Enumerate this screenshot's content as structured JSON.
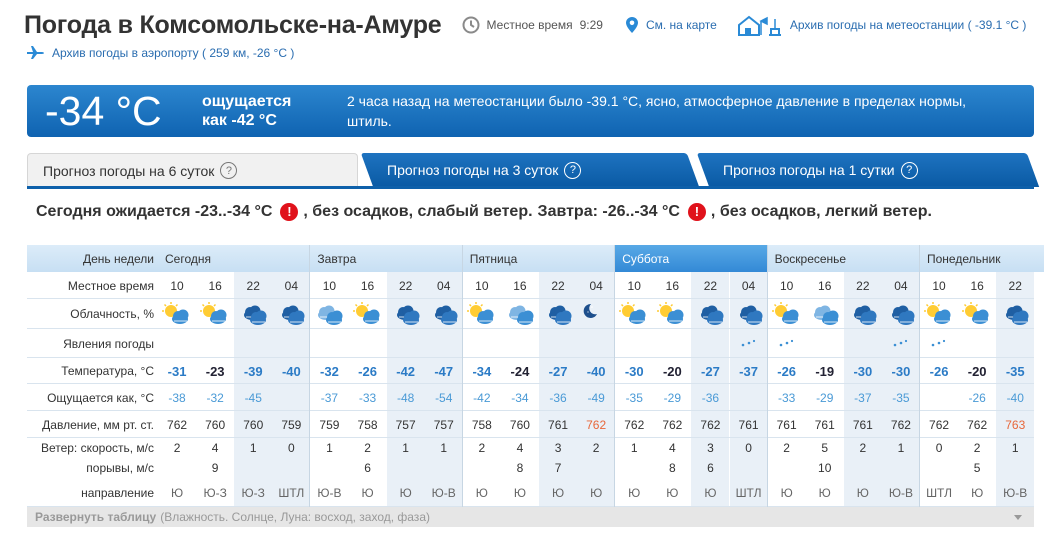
{
  "header": {
    "title": "Погода в Комсомольске-на-Амуре",
    "local_time_label": "Местное время",
    "local_time": "9:29",
    "map_link": "См. на карте",
    "archive_station": "Архив погоды на метеостанции ( -39.1 °C )",
    "archive_airport": "Архив погоды в аэропорту ( 259 км, -26 °C )"
  },
  "current": {
    "temp": "-34 °C",
    "feels_label": "ощущается",
    "feels_value": "как -42 °C",
    "description": "2 часа назад на метеостанции было -39.1 °C, ясно, атмосферное давление в пределах нормы, штиль."
  },
  "tabs": [
    {
      "label": "Прогноз погоды на 6 суток",
      "active": true
    },
    {
      "label": "Прогноз погоды на 3 суток"
    },
    {
      "label": "Прогноз погоды на 1 сутки"
    }
  ],
  "help_icon": "?",
  "summary": {
    "today": "Сегодня ожидается -23..-34 °C",
    "today_rest": ", без осадков, слабый ветер.",
    "tomorrow": "Завтра: -26..-34 °C",
    "tomorrow_rest": ", без осадков, легкий ветер.",
    "alert_symbol": "!"
  },
  "row_labels": {
    "weekday": "День недели",
    "local_time": "Местное время",
    "cloud": "Облачность, %",
    "phenomena": "Явления погоды",
    "temperature": "Температура, °C",
    "feels": "Ощущается как, °C",
    "pressure": "Давление, мм рт. ст.",
    "wind_speed": "Ветер: скорость, м/с",
    "gusts": "порывы, м/с",
    "direction": "направление"
  },
  "days": [
    {
      "name": "Сегодня",
      "weekend": false
    },
    {
      "name": "Завтра",
      "weekend": false
    },
    {
      "name": "Пятница",
      "weekend": false
    },
    {
      "name": "Суббота",
      "weekend": true
    },
    {
      "name": "Воскресенье",
      "weekend": false
    },
    {
      "name": "Понедельник",
      "weekend": false
    }
  ],
  "columns": [
    {
      "time": "10",
      "icon": "sun-cloud",
      "snow": false,
      "temp": "-31",
      "feels": "-38",
      "pressure": "762",
      "wind": "2",
      "gust": "",
      "dir": "Ю"
    },
    {
      "time": "16",
      "icon": "sun-cloud",
      "snow": false,
      "temp": "-23",
      "feels": "-32",
      "pressure": "760",
      "wind": "4",
      "gust": "9",
      "dir": "Ю-З"
    },
    {
      "time": "22",
      "icon": "moon-cloud",
      "snow": false,
      "temp": "-39",
      "feels": "-45",
      "pressure": "760",
      "wind": "1",
      "gust": "",
      "dir": "Ю-З"
    },
    {
      "time": "04",
      "icon": "moon-cloud",
      "snow": false,
      "temp": "-40",
      "feels": "",
      "pressure": "759",
      "wind": "0",
      "gust": "",
      "dir": "ШТЛ"
    },
    {
      "time": "10",
      "icon": "cloudy",
      "snow": false,
      "temp": "-32",
      "feels": "-37",
      "pressure": "759",
      "wind": "1",
      "gust": "",
      "dir": "Ю-В"
    },
    {
      "time": "16",
      "icon": "sun-cloud",
      "snow": false,
      "temp": "-26",
      "feels": "-33",
      "pressure": "758",
      "wind": "2",
      "gust": "6",
      "dir": "Ю"
    },
    {
      "time": "22",
      "icon": "moon-cloud",
      "snow": false,
      "temp": "-42",
      "feels": "-48",
      "pressure": "757",
      "wind": "1",
      "gust": "",
      "dir": "Ю"
    },
    {
      "time": "04",
      "icon": "moon-cloud",
      "snow": false,
      "temp": "-47",
      "feels": "-54",
      "pressure": "757",
      "wind": "1",
      "gust": "",
      "dir": "Ю-В"
    },
    {
      "time": "10",
      "icon": "sun-cloud",
      "snow": false,
      "temp": "-34",
      "feels": "-42",
      "pressure": "758",
      "wind": "2",
      "gust": "",
      "dir": "Ю"
    },
    {
      "time": "16",
      "icon": "cloudy",
      "snow": false,
      "temp": "-24",
      "feels": "-34",
      "pressure": "760",
      "wind": "4",
      "gust": "8",
      "dir": "Ю"
    },
    {
      "time": "22",
      "icon": "moon-cloud",
      "snow": false,
      "temp": "-27",
      "feels": "-36",
      "pressure": "761",
      "wind": "3",
      "gust": "7",
      "dir": "Ю"
    },
    {
      "time": "04",
      "icon": "moon",
      "snow": false,
      "temp": "-40",
      "feels": "-49",
      "pressure": "762",
      "wind": "2",
      "gust": "",
      "dir": "Ю",
      "pressure_hl": true
    },
    {
      "time": "10",
      "icon": "sun-cloud",
      "snow": false,
      "temp": "-30",
      "feels": "-35",
      "pressure": "762",
      "wind": "1",
      "gust": "",
      "dir": "Ю"
    },
    {
      "time": "16",
      "icon": "sun-cloud",
      "snow": false,
      "temp": "-20",
      "feels": "-29",
      "pressure": "762",
      "wind": "4",
      "gust": "8",
      "dir": "Ю"
    },
    {
      "time": "22",
      "icon": "moon-cloud",
      "snow": false,
      "temp": "-27",
      "feels": "-36",
      "pressure": "762",
      "wind": "3",
      "gust": "6",
      "dir": "Ю"
    },
    {
      "time": "04",
      "icon": "moon-cloud",
      "snow": true,
      "temp": "-37",
      "feels": "",
      "pressure": "761",
      "wind": "0",
      "gust": "",
      "dir": "ШТЛ"
    },
    {
      "time": "10",
      "icon": "sun-cloud",
      "snow": true,
      "temp": "-26",
      "feels": "-33",
      "pressure": "761",
      "wind": "2",
      "gust": "",
      "dir": "Ю"
    },
    {
      "time": "16",
      "icon": "cloudy",
      "snow": false,
      "temp": "-19",
      "feels": "-29",
      "pressure": "761",
      "wind": "5",
      "gust": "10",
      "dir": "Ю"
    },
    {
      "time": "22",
      "icon": "moon-cloud",
      "snow": false,
      "temp": "-30",
      "feels": "-37",
      "pressure": "761",
      "wind": "2",
      "gust": "",
      "dir": "Ю"
    },
    {
      "time": "04",
      "icon": "moon-cloud",
      "snow": true,
      "temp": "-30",
      "feels": "-35",
      "pressure": "762",
      "wind": "1",
      "gust": "",
      "dir": "Ю-В"
    },
    {
      "time": "10",
      "icon": "sun-cloud",
      "snow": true,
      "temp": "-26",
      "feels": "",
      "pressure": "762",
      "wind": "0",
      "gust": "",
      "dir": "ШТЛ"
    },
    {
      "time": "16",
      "icon": "sun-cloud",
      "snow": false,
      "temp": "-20",
      "feels": "-26",
      "pressure": "762",
      "wind": "2",
      "gust": "5",
      "dir": "Ю"
    },
    {
      "time": "22",
      "icon": "moon-cloud",
      "snow": false,
      "temp": "-35",
      "feels": "-40",
      "pressure": "763",
      "wind": "1",
      "gust": "",
      "dir": "Ю-В",
      "pressure_hl": true
    }
  ],
  "footer": {
    "expand": "Развернуть таблицу",
    "details": "(Влажность. Солнце, Луна: восход, заход, фаза)"
  },
  "colors": {
    "temp": "#2b7bc6",
    "feels": "#4a9ad6",
    "night_bg": "#e9f0f7",
    "weekend_header": "#3d8fd8",
    "pressure_hl": "#e8673a",
    "banner": "#1a72c0"
  }
}
